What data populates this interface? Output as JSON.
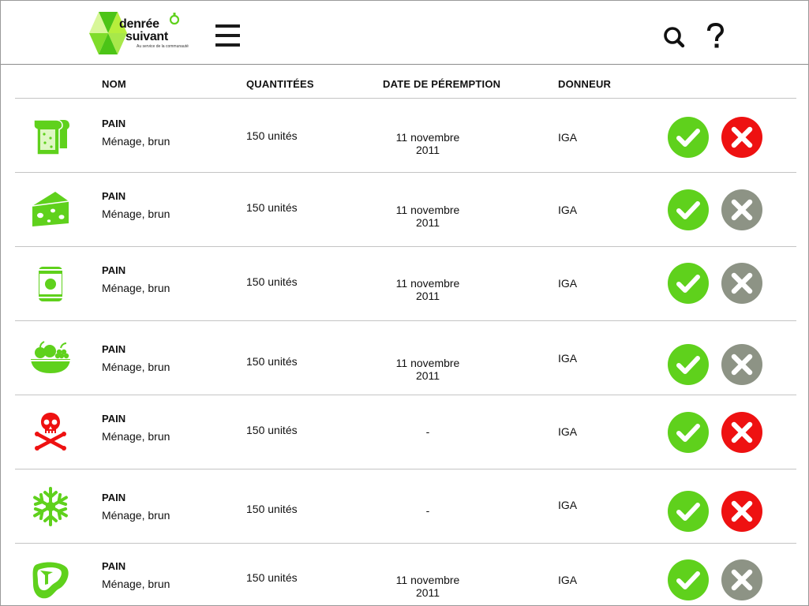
{
  "app": {
    "logo_line1": "denrée",
    "logo_line2": "suivant",
    "logo_tagline": "Au service de la communauté"
  },
  "colors": {
    "brand_green": "#5fd11c",
    "reject_red": "#ee1111",
    "reject_grey": "#8d9385",
    "danger_red": "#ee1111"
  },
  "header": {
    "menu_icon": "hamburger-menu-icon",
    "search_icon": "search-icon",
    "help_icon": "help-icon"
  },
  "table": {
    "columns": {
      "name": "NOM",
      "quantity": "QUANTITÉES",
      "expiry": "DATE DE PÉREMPTION",
      "donor": "DONNEUR"
    },
    "rows": [
      {
        "icon": "bread-icon",
        "name": "PAIN",
        "desc": "Ménage, brun",
        "qty": "150 unités",
        "date": "11 novembre 2011",
        "donor": "IGA",
        "accept_icon": "check-icon",
        "reject_icon": "close-icon",
        "reject_state": "active"
      },
      {
        "icon": "cheese-icon",
        "name": "PAIN",
        "desc": "Ménage, brun",
        "qty": "150 unités",
        "date": "11 novembre 2011",
        "donor": "IGA",
        "accept_icon": "check-icon",
        "reject_icon": "close-icon",
        "reject_state": "muted"
      },
      {
        "icon": "canned-food-icon",
        "name": "PAIN",
        "desc": "Ménage, brun",
        "qty": "150 unités",
        "date": "11 novembre 2011",
        "donor": "IGA",
        "accept_icon": "check-icon",
        "reject_icon": "close-icon",
        "reject_state": "muted"
      },
      {
        "icon": "fruit-bowl-icon",
        "name": "PAIN",
        "desc": "Ménage, brun",
        "qty": "150 unités",
        "date": "11 novembre 2011",
        "donor": "IGA",
        "accept_icon": "check-icon",
        "reject_icon": "close-icon",
        "reject_state": "muted"
      },
      {
        "icon": "skull-crossbones-icon",
        "name": "PAIN",
        "desc": "Ménage, brun",
        "qty": "150 unités",
        "date": "-",
        "donor": "IGA",
        "accept_icon": "check-icon",
        "reject_icon": "close-icon",
        "reject_state": "active"
      },
      {
        "icon": "snowflake-icon",
        "name": "PAIN",
        "desc": "Ménage, brun",
        "qty": "150 unités",
        "date": "-",
        "donor": "IGA",
        "accept_icon": "check-icon",
        "reject_icon": "close-icon",
        "reject_state": "active"
      },
      {
        "icon": "steak-icon",
        "name": "PAIN",
        "desc": "Ménage, brun",
        "qty": "150 unités",
        "date": "11 novembre 2011",
        "donor": "IGA",
        "accept_icon": "check-icon",
        "reject_icon": "close-icon",
        "reject_state": "muted"
      }
    ]
  }
}
